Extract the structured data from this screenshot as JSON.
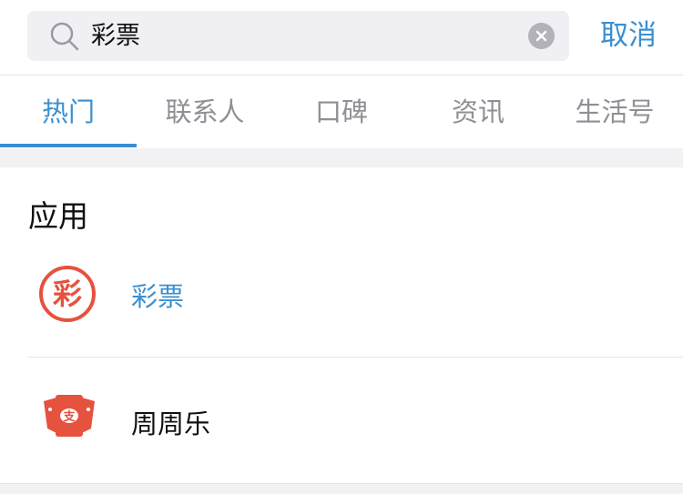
{
  "search": {
    "query": "彩票",
    "cancel_label": "取消"
  },
  "tabs": [
    {
      "label": "热门",
      "active": true
    },
    {
      "label": "联系人",
      "active": false
    },
    {
      "label": "口碑",
      "active": false
    },
    {
      "label": "资讯",
      "active": false
    },
    {
      "label": "生活号",
      "active": false
    }
  ],
  "section": {
    "title": "应用",
    "items": [
      {
        "name": "彩票",
        "icon": "lottery-icon",
        "icon_char": "彩",
        "highlight_color": "#3a8fd0"
      },
      {
        "name": "周周乐",
        "icon": "zhouzhoule-icon",
        "icon_char": "支"
      }
    ]
  },
  "colors": {
    "accent": "#3a8fd0",
    "lottery_red": "#e5523e"
  }
}
